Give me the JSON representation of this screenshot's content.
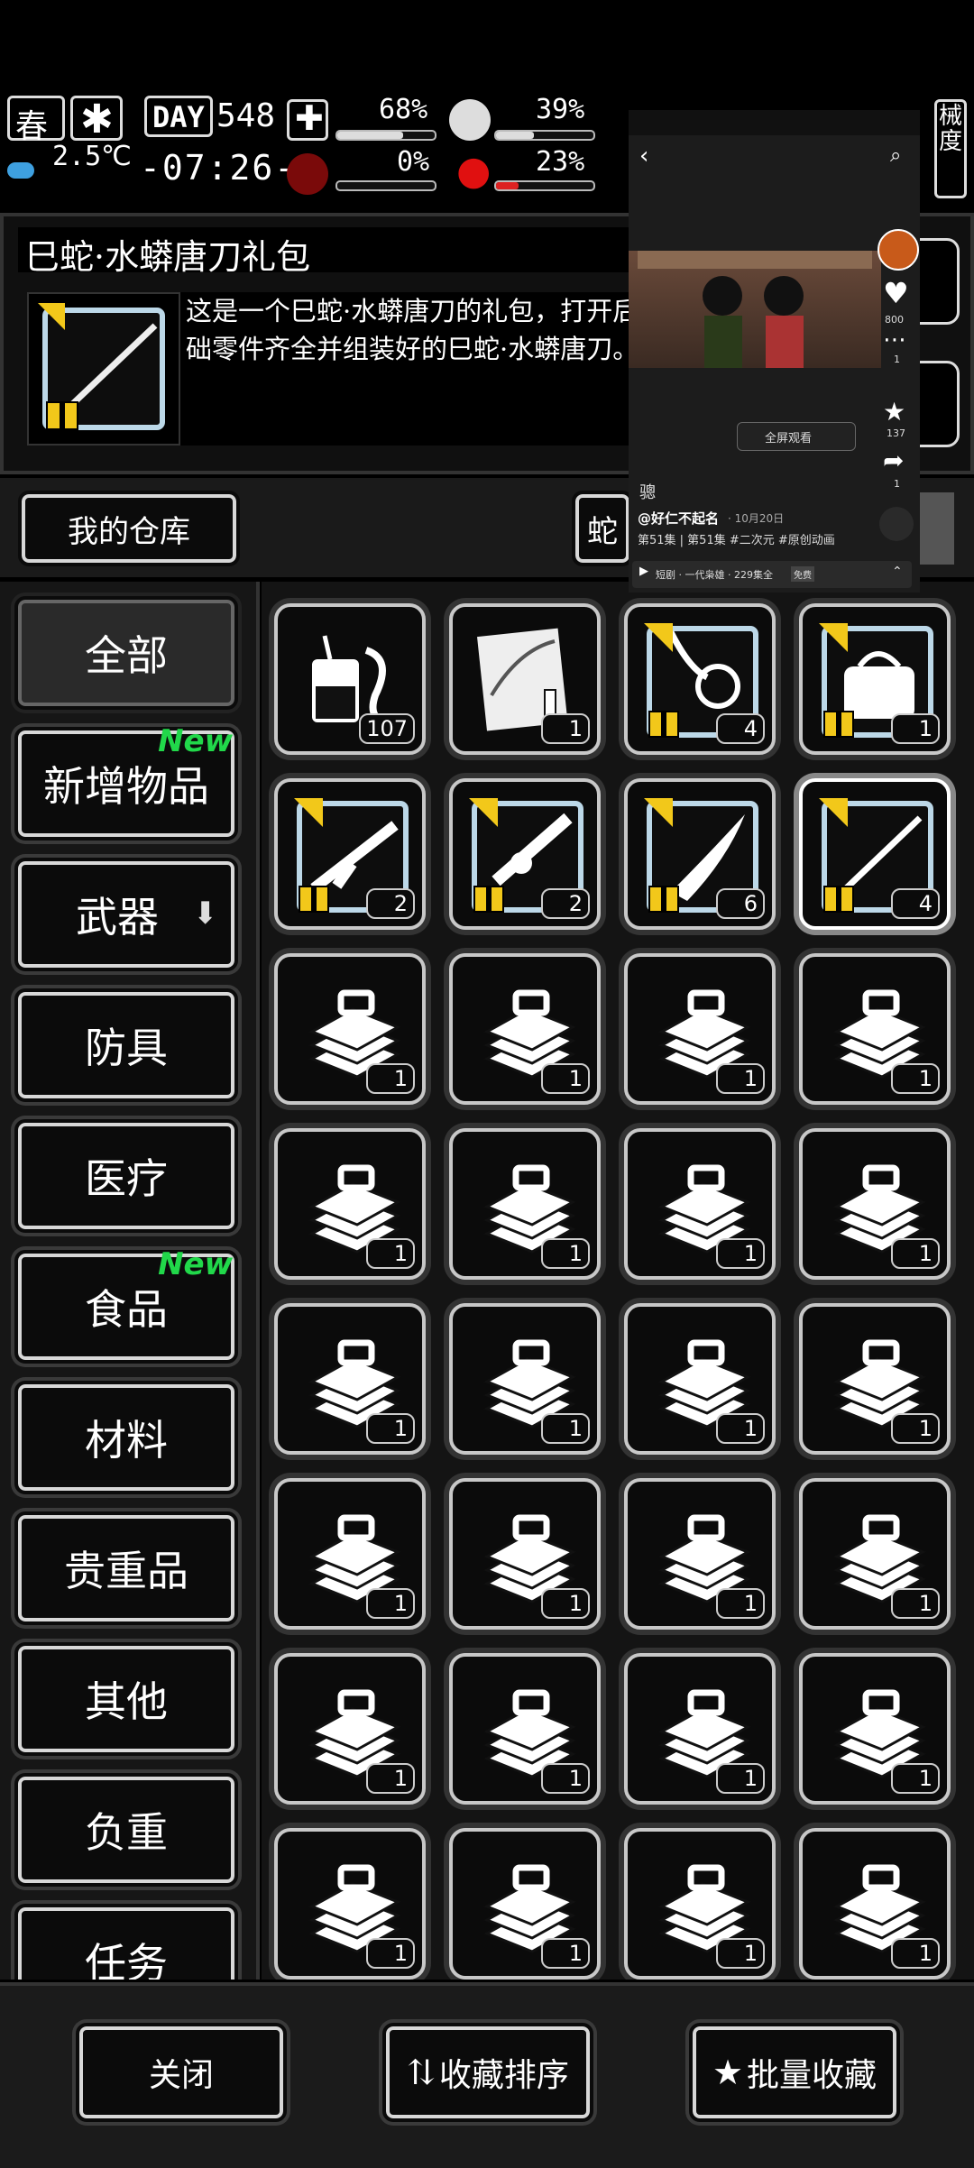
{
  "hud": {
    "season": "春",
    "temperature": "2.5℃",
    "day_label": "DAY",
    "day_number": "548",
    "clock": "-07:26-",
    "health_pct": "68%",
    "health_level": 0.68,
    "stomach_pct": "39%",
    "stomach_level": 0.39,
    "infection_pct": "0%",
    "infection_level": 0.0,
    "blood_pct": "23%",
    "blood_level": 0.23,
    "right_partial": "械\n度"
  },
  "item_detail": {
    "title": "巳蛇·水蟒唐刀礼包",
    "description": "这是一个巳蛇·水蟒唐刀的礼包，打开后\n础零件齐全并组装好的巳蛇·水蟒唐刀。"
  },
  "warehouse": {
    "my_warehouse_label": "我的仓库",
    "right_partial_label": "蛇"
  },
  "categories": [
    {
      "label": "全部",
      "active": true,
      "new": false
    },
    {
      "label": "新增物品",
      "active": false,
      "new": true
    },
    {
      "label": "武器",
      "active": false,
      "new": false,
      "arrow": true
    },
    {
      "label": "防具",
      "active": false,
      "new": false
    },
    {
      "label": "医疗",
      "active": false,
      "new": false
    },
    {
      "label": "食品",
      "active": false,
      "new": true
    },
    {
      "label": "材料",
      "active": false,
      "new": false
    },
    {
      "label": "贵重品",
      "active": false,
      "new": false
    },
    {
      "label": "其他",
      "active": false,
      "new": false
    },
    {
      "label": "负重",
      "active": false,
      "new": false
    },
    {
      "label": "任务",
      "active": false,
      "new": false
    }
  ],
  "new_tag": "New",
  "items": [
    {
      "icon": "drink-snake-icon",
      "count": "107",
      "gift": false
    },
    {
      "icon": "blueprint-icon",
      "count": "1",
      "gift": false
    },
    {
      "icon": "whip-gift-icon",
      "count": "4",
      "gift": true
    },
    {
      "icon": "bag-gift-icon",
      "count": "1",
      "gift": true
    },
    {
      "icon": "rifle-gift-icon",
      "count": "2",
      "gift": true
    },
    {
      "icon": "gun-gift-icon",
      "count": "2",
      "gift": true
    },
    {
      "icon": "blade-gift-icon",
      "count": "6",
      "gift": true
    },
    {
      "icon": "katana-gift-icon",
      "count": "4",
      "gift": true
    },
    {
      "icon": "toolbox-icon",
      "count": "1"
    },
    {
      "icon": "toolbox-icon",
      "count": "1"
    },
    {
      "icon": "toolbox-icon",
      "count": "1"
    },
    {
      "icon": "toolbox-icon",
      "count": "1"
    },
    {
      "icon": "toolbox-icon",
      "count": "1"
    },
    {
      "icon": "toolbox-icon",
      "count": "1"
    },
    {
      "icon": "toolbox-icon",
      "count": "1"
    },
    {
      "icon": "toolbox-icon",
      "count": "1"
    },
    {
      "icon": "toolbox-icon",
      "count": "1"
    },
    {
      "icon": "toolbox-icon",
      "count": "1"
    },
    {
      "icon": "toolbox-icon",
      "count": "1"
    },
    {
      "icon": "toolbox-icon",
      "count": "1"
    },
    {
      "icon": "toolbox-icon",
      "count": "1"
    },
    {
      "icon": "toolbox-icon",
      "count": "1"
    },
    {
      "icon": "toolbox-icon",
      "count": "1"
    },
    {
      "icon": "toolbox-icon",
      "count": "1"
    },
    {
      "icon": "toolbox-icon",
      "count": "1"
    },
    {
      "icon": "toolbox-icon",
      "count": "1"
    },
    {
      "icon": "toolbox-icon",
      "count": "1"
    },
    {
      "icon": "toolbox-icon",
      "count": "1"
    },
    {
      "icon": "toolbox-icon",
      "count": "1"
    },
    {
      "icon": "toolbox-icon",
      "count": "1"
    },
    {
      "icon": "toolbox-icon",
      "count": "1"
    },
    {
      "icon": "toolbox-icon",
      "count": "1"
    }
  ],
  "bottom": {
    "close": "关闭",
    "sort": "收藏排序",
    "batch": "批量收藏"
  },
  "overlay": {
    "fullscreen": "全屏观看",
    "likes": "800",
    "comments": "1",
    "stars": "137",
    "shares": "1",
    "tag_char": "骢",
    "author": "@好仁不起名",
    "date": "· 10月20日",
    "caption": "第51集 | 第51集 #二次元 #原创动画",
    "series": "短剧 · 一代枭雄 · 229集全",
    "series_badge": "免费"
  }
}
